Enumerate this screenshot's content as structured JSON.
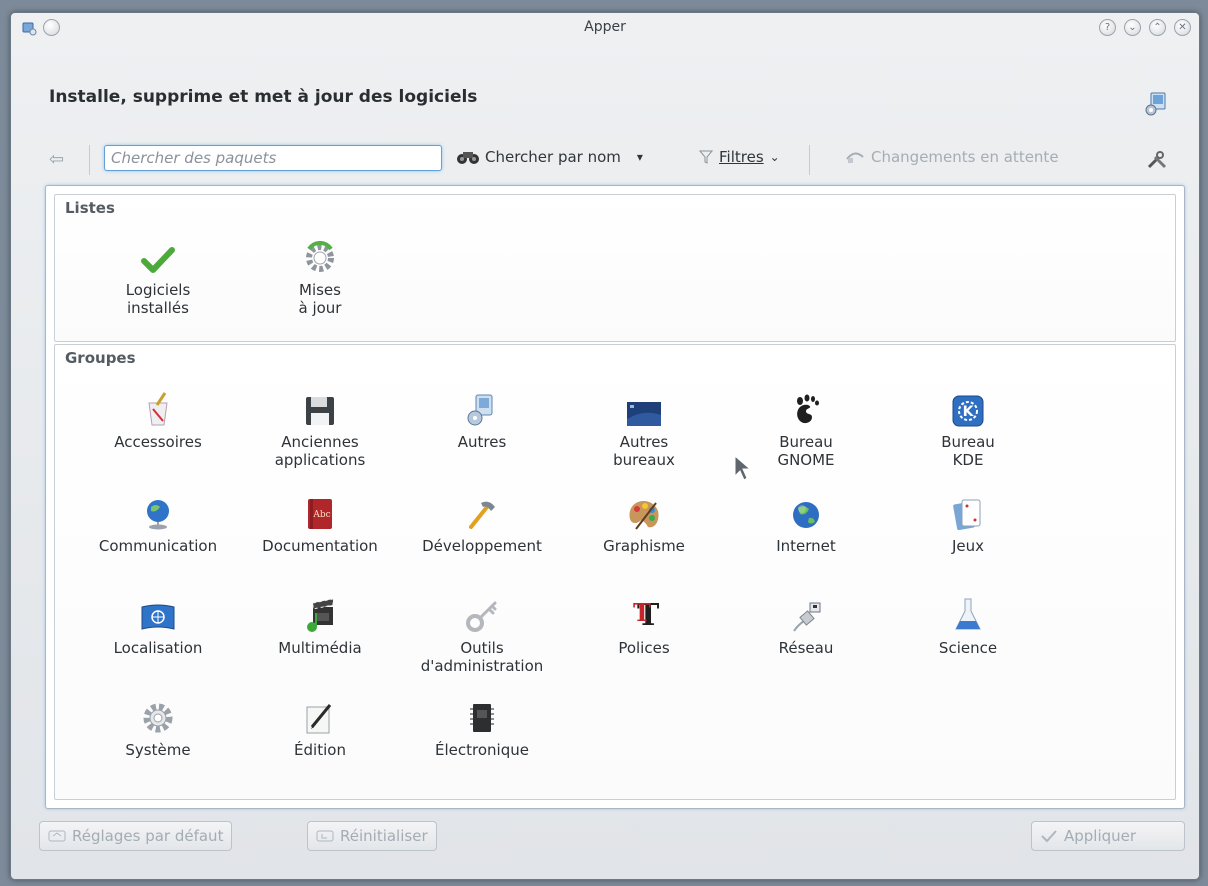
{
  "window": {
    "title": "Apper"
  },
  "header": {
    "title": "Installe, supprime et met à jour des logiciels"
  },
  "toolbar": {
    "search_placeholder": "Chercher des paquets",
    "search_by_label": "Chercher par nom",
    "filters_label": "Filtres",
    "pending_label": "Changements en attente"
  },
  "lists": {
    "title": "Listes",
    "items": [
      {
        "label": "Logiciels\ninstallés",
        "icon": "checkmark-icon"
      },
      {
        "label": "Mises\nà jour",
        "icon": "update-gear-icon"
      }
    ]
  },
  "groups": {
    "title": "Groupes",
    "items": [
      {
        "label": "Accessoires",
        "icon": "accessories-icon"
      },
      {
        "label": "Anciennes\napplications",
        "icon": "floppy-disk-icon"
      },
      {
        "label": "Autres",
        "icon": "package-icon"
      },
      {
        "label": "Autres\nbureaux",
        "icon": "desktop-icon"
      },
      {
        "label": "Bureau\nGNOME",
        "icon": "gnome-foot-icon"
      },
      {
        "label": "Bureau\nKDE",
        "icon": "kde-icon"
      },
      {
        "label": "Communication",
        "icon": "globe-icon"
      },
      {
        "label": "Documentation",
        "icon": "book-icon"
      },
      {
        "label": "Développement",
        "icon": "hammer-icon"
      },
      {
        "label": "Graphisme",
        "icon": "palette-icon"
      },
      {
        "label": "Internet",
        "icon": "earth-icon"
      },
      {
        "label": "Jeux",
        "icon": "cards-icon"
      },
      {
        "label": "Localisation",
        "icon": "flag-icon"
      },
      {
        "label": "Multimédia",
        "icon": "clapper-icon"
      },
      {
        "label": "Outils\nd'administration",
        "icon": "key-icon"
      },
      {
        "label": "Polices",
        "icon": "font-icon"
      },
      {
        "label": "Réseau",
        "icon": "network-plug-icon"
      },
      {
        "label": "Science",
        "icon": "flask-icon"
      },
      {
        "label": "Système",
        "icon": "gear-icon"
      },
      {
        "label": "Édition",
        "icon": "edit-pen-icon"
      },
      {
        "label": "Électronique",
        "icon": "chip-icon"
      }
    ]
  },
  "footer": {
    "defaults_label": "Réglages par défaut",
    "reset_label": "Réinitialiser",
    "apply_label": "Appliquer"
  }
}
